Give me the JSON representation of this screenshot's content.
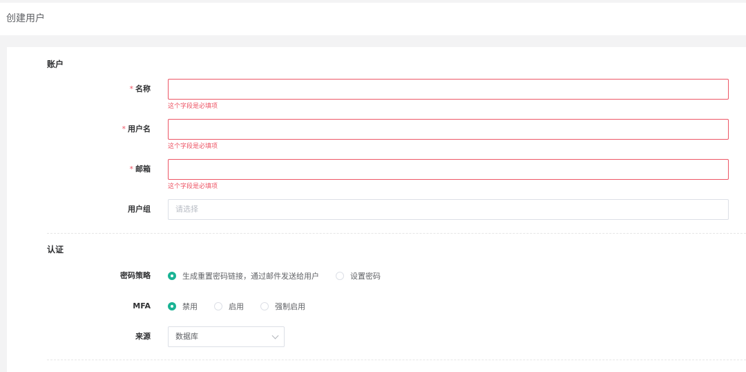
{
  "header": {
    "title": "创建用户"
  },
  "sections": {
    "account": "账户",
    "auth": "认证"
  },
  "form": {
    "name": {
      "required_mark": "*",
      "label": "名称",
      "value": "",
      "error": "这个字段是必填项"
    },
    "username": {
      "required_mark": "*",
      "label": "用户名",
      "value": "",
      "error": "这个字段是必填项"
    },
    "email": {
      "required_mark": "*",
      "label": "邮箱",
      "value": "",
      "error": "这个字段是必填项"
    },
    "groups": {
      "label": "用户组",
      "placeholder": "请选择"
    },
    "password_strategy": {
      "label": "密码策略",
      "options": [
        "生成重置密码链接，通过邮件发送给用户",
        "设置密码"
      ],
      "selected": 0
    },
    "mfa": {
      "label": "MFA",
      "options": [
        "禁用",
        "启用",
        "强制启用"
      ],
      "selected": 0
    },
    "source": {
      "label": "来源",
      "value": "数据库"
    }
  },
  "colors": {
    "accent": "#1ab394",
    "error": "#ed5565",
    "border": "#dcdfe6"
  }
}
